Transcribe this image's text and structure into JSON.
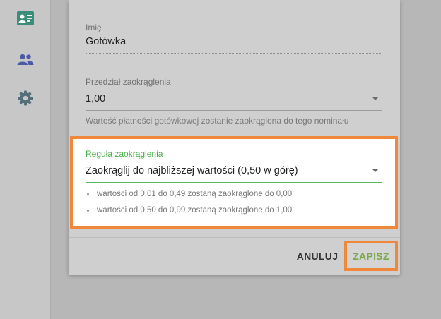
{
  "sidebar": {
    "items": [
      {
        "icon": "contact-card-icon",
        "color": "#3a8d78"
      },
      {
        "icon": "people-icon",
        "color": "#4b5aa6"
      },
      {
        "icon": "gear-icon",
        "color": "#546e7a"
      }
    ]
  },
  "dialog": {
    "name": {
      "label": "Imię",
      "value": "Gotówka"
    },
    "rounding_interval": {
      "label": "Przedział zaokrąglenia",
      "value": "1,00",
      "hint": "Wartość płatności gotówkowej zostanie zaokrąglona do tego nominału"
    },
    "rounding_rule": {
      "label": "Reguła zaokrąglenia",
      "value": "Zaokrąglij do najbliższej wartości (0,50 w górę)",
      "examples": [
        "wartości od 0,01 do 0,49 zostaną zaokrąglone do 0,00",
        "wartości od 0,50 do 0,99 zostaną zaokrąglone do 1,00"
      ]
    },
    "actions": {
      "cancel_label": "ANULUJ",
      "save_label": "ZAPISZ"
    }
  },
  "colors": {
    "accent_green": "#5cb85c",
    "save_green": "#7aa84e",
    "highlight_orange": "#f0883b"
  }
}
